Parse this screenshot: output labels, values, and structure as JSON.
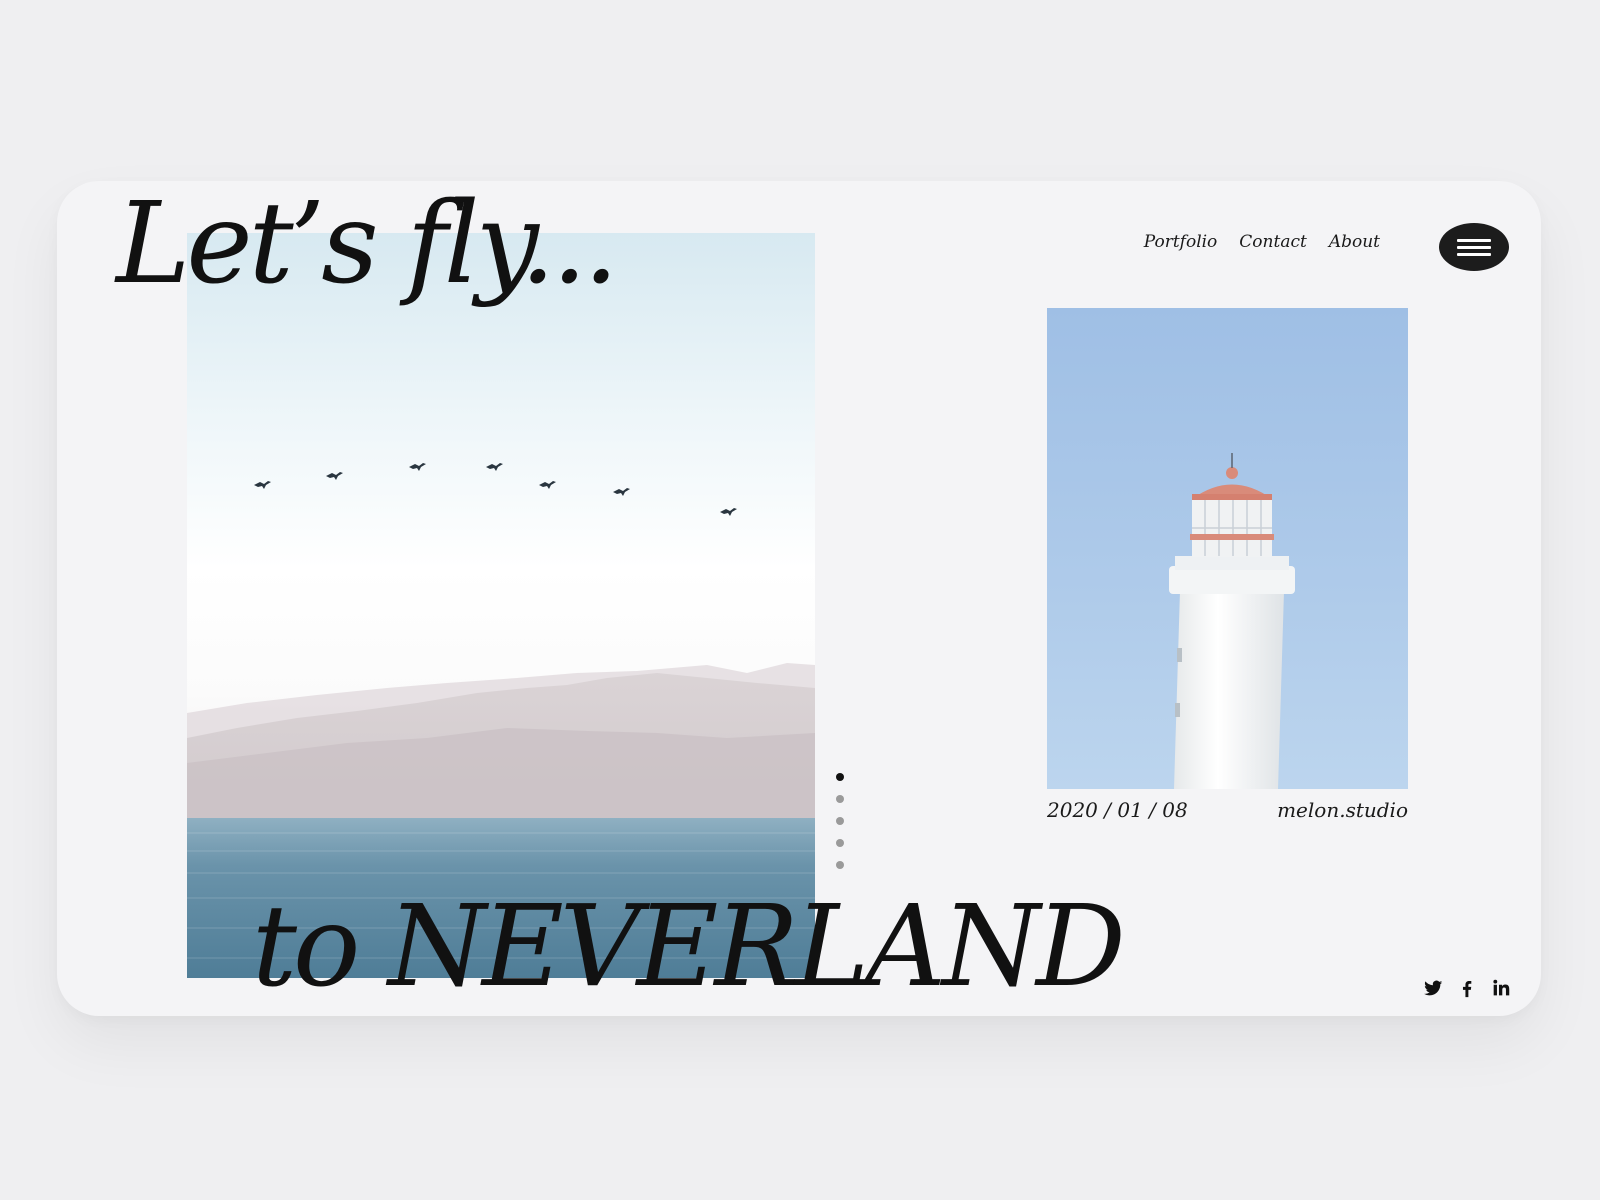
{
  "hero": {
    "title_line1": "Let’s fly...",
    "title_line2": "to NEVERLAND"
  },
  "nav": {
    "items": [
      {
        "label": "Portfolio"
      },
      {
        "label": "Contact"
      },
      {
        "label": "About"
      }
    ],
    "menu_icon": "hamburger-menu-icon"
  },
  "feature": {
    "date": "2020 / 01 / 08",
    "author": "melon.studio"
  },
  "slider": {
    "count": 5,
    "active_index": 0
  },
  "social": [
    {
      "icon": "twitter-icon"
    },
    {
      "icon": "facebook-icon"
    },
    {
      "icon": "linkedin-icon"
    }
  ],
  "colors": {
    "background": "#efeff1",
    "card": "#f4f4f6",
    "text": "#111111",
    "menu_button": "#1c1c1c",
    "sea": "#5e8aa3",
    "sky_light": "#d9ebf2",
    "lighthouse_sky": "#a9c5e6",
    "lighthouse_roof": "#d98b7a"
  }
}
